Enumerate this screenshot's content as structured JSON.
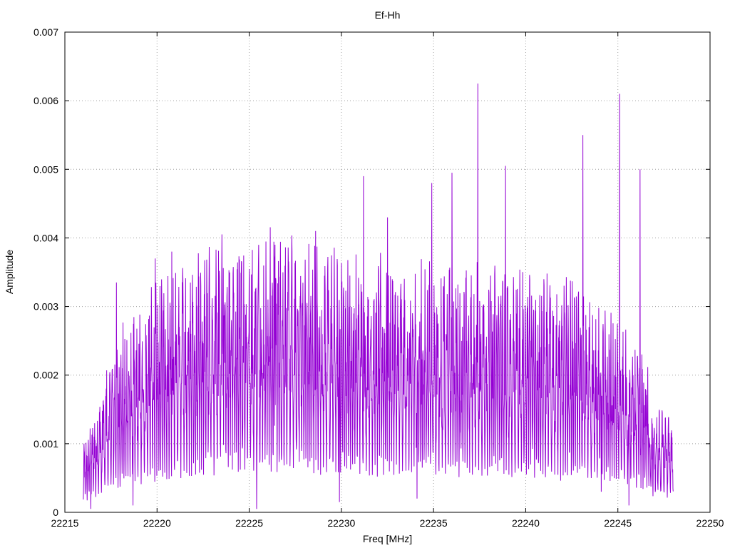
{
  "chart_data": {
    "type": "line",
    "title": "Ef-Hh",
    "xlabel": "Freq [MHz]",
    "ylabel": "Amplitude",
    "xlim": [
      22215,
      22250
    ],
    "ylim": [
      0,
      0.007
    ],
    "xticks": [
      "22215",
      "22220",
      "22225",
      "22230",
      "22235",
      "22240",
      "22245",
      "22250"
    ],
    "yticks": [
      "0",
      "0.001",
      "0.002",
      "0.003",
      "0.004",
      "0.005",
      "0.006",
      "0.007"
    ],
    "grid": true,
    "line_color": "#9400d3",
    "x_range": [
      22216.0,
      22248.0
    ],
    "peaks": [
      {
        "x": 22217.8,
        "y": 0.00335
      },
      {
        "x": 22219.9,
        "y": 0.0037
      },
      {
        "x": 22220.8,
        "y": 0.0038
      },
      {
        "x": 22223.6,
        "y": 0.00356
      },
      {
        "x": 22225.0,
        "y": 0.00338
      },
      {
        "x": 22226.4,
        "y": 0.0039
      },
      {
        "x": 22228.6,
        "y": 0.0041
      },
      {
        "x": 22231.2,
        "y": 0.0049
      },
      {
        "x": 22232.5,
        "y": 0.0043
      },
      {
        "x": 22234.9,
        "y": 0.0048
      },
      {
        "x": 22236.0,
        "y": 0.00495
      },
      {
        "x": 22237.4,
        "y": 0.00625
      },
      {
        "x": 22238.9,
        "y": 0.00505
      },
      {
        "x": 22243.1,
        "y": 0.0055
      },
      {
        "x": 22245.1,
        "y": 0.0061
      },
      {
        "x": 22246.2,
        "y": 0.005
      }
    ],
    "troughs": [
      {
        "x": 22216.4,
        "y": 5e-05
      },
      {
        "x": 22218.7,
        "y": 0.0001
      },
      {
        "x": 22225.4,
        "y": 5e-05
      },
      {
        "x": 22229.9,
        "y": 0.00015
      },
      {
        "x": 22234.1,
        "y": 0.0002
      },
      {
        "x": 22244.1,
        "y": 0.0003
      },
      {
        "x": 22245.6,
        "y": 0.0001
      }
    ]
  }
}
